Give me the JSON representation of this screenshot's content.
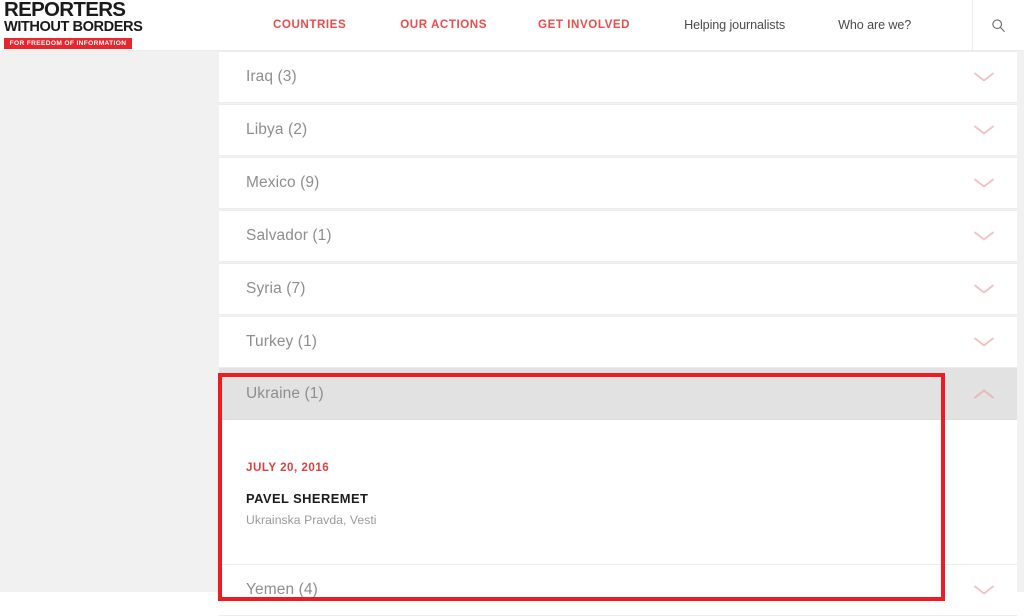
{
  "header": {
    "logo": {
      "line1": "REPORTERS",
      "line2": "WITHOUT BORDERS",
      "tagline": "FOR FREEDOM OF INFORMATION",
      "bar_color": "#e8262b"
    },
    "nav": [
      {
        "label": "COUNTRIES",
        "style": "accent"
      },
      {
        "label": "OUR ACTIONS",
        "style": "accent"
      },
      {
        "label": "GET INVOLVED",
        "style": "accent"
      },
      {
        "label": "Helping journalists",
        "style": "plain"
      },
      {
        "label": "Who are we?",
        "style": "plain"
      }
    ],
    "search_icon": "search-icon",
    "accent_color": "#ee4b4b"
  },
  "accordion": {
    "rows": [
      {
        "label": "Iraq (3)",
        "count": 3,
        "country": "Iraq",
        "expanded": false,
        "icon": "chevron-down-icon"
      },
      {
        "label": "Libya (2)",
        "count": 2,
        "country": "Libya",
        "expanded": false,
        "icon": "chevron-down-icon"
      },
      {
        "label": "Mexico (9)",
        "count": 9,
        "country": "Mexico",
        "expanded": false,
        "icon": "chevron-down-icon"
      },
      {
        "label": "Salvador (1)",
        "count": 1,
        "country": "Salvador",
        "expanded": false,
        "icon": "chevron-down-icon"
      },
      {
        "label": "Syria (7)",
        "count": 7,
        "country": "Syria",
        "expanded": false,
        "icon": "chevron-down-icon"
      },
      {
        "label": "Turkey (1)",
        "count": 1,
        "country": "Turkey",
        "expanded": false,
        "icon": "chevron-down-icon"
      }
    ],
    "expanded_row": {
      "label": "Ukraine (1)",
      "count": 1,
      "country": "Ukraine",
      "expanded": true,
      "icon": "chevron-up-icon",
      "entries": [
        {
          "date": "JULY 20, 2016",
          "name": "PAVEL SHEREMET",
          "outlet": "Ukrainska Pravda, Vesti"
        }
      ]
    },
    "trailing_rows": [
      {
        "label": "Yemen (4)",
        "count": 4,
        "country": "Yemen",
        "expanded": false,
        "icon": "chevron-down-icon"
      }
    ]
  },
  "annotation": {
    "highlight_color": "#ee1b23",
    "target": "Ukraine (1)"
  }
}
